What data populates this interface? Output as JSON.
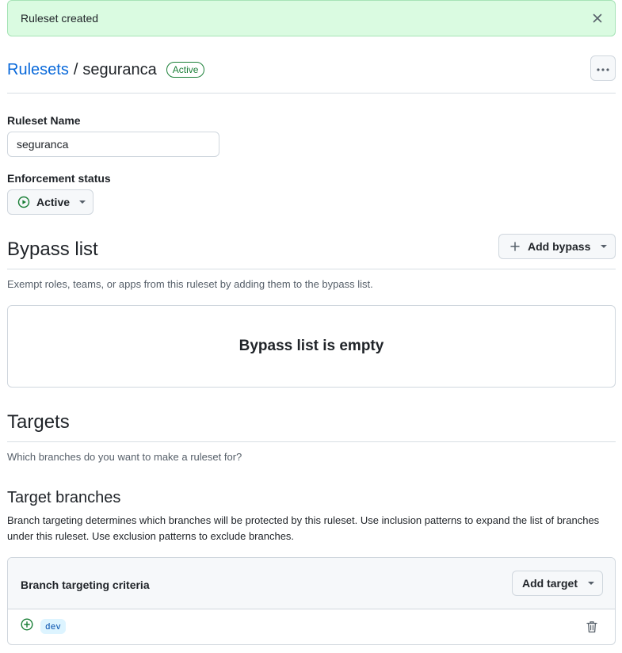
{
  "flash": {
    "message": "Ruleset created",
    "close_icon": "x-icon"
  },
  "header": {
    "breadcrumb_root": "Rulesets",
    "separator": "/",
    "ruleset_name": "seguranca",
    "status_badge": "Active",
    "more_icon": "kebab-horizontal-icon"
  },
  "form": {
    "name_label": "Ruleset Name",
    "name_value": "seguranca",
    "enforcement_label": "Enforcement status",
    "enforcement_value": "Active",
    "enforcement_icon": "play-circle-icon"
  },
  "bypass": {
    "title": "Bypass list",
    "add_label": "Add bypass",
    "add_icon": "plus-icon",
    "description": "Exempt roles, teams, or apps from this ruleset by adding them to the bypass list.",
    "empty_text": "Bypass list is empty"
  },
  "targets": {
    "title": "Targets",
    "description": "Which branches do you want to make a ruleset for?",
    "branches_title": "Target branches",
    "branches_description": "Branch targeting determines which branches will be protected by this ruleset. Use inclusion patterns to expand the list of branches under this ruleset. Use exclusion patterns to exclude branches.",
    "criteria_title": "Branch targeting criteria",
    "add_target_label": "Add target",
    "items": [
      {
        "pattern": "dev",
        "icon": "plus-circle-icon",
        "delete_icon": "trash-icon"
      }
    ]
  },
  "colors": {
    "accent_link": "#0969da",
    "success": "#1a7f37",
    "flash_bg": "#dafbe1",
    "chip_bg": "#ddf4ff"
  }
}
